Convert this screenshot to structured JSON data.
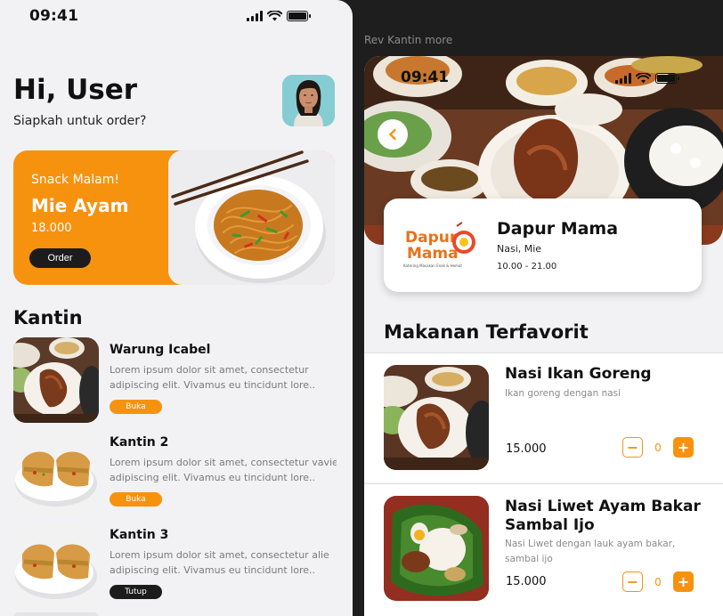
{
  "left_phone": {
    "status_time": "09:41",
    "greeting": "Hi, User",
    "subtitle": "Siapkah untuk order?",
    "promo": {
      "label": "Snack Malam!",
      "title": "Mie Ayam",
      "price": "18.000",
      "button": "Order"
    },
    "kantin_title": "Kantin",
    "kantin_items": [
      {
        "name": "Warung Icabel",
        "desc_line1": "Lorem ipsum dolor sit amet, consectetur",
        "desc_line2": "adipiscing elit. Vivamus eu tincidunt lore..",
        "status": "Buka"
      },
      {
        "name": "Kantin 2",
        "desc_line1": "Lorem ipsum dolor sit amet, consectetur vavie",
        "desc_line2": "adipiscing elit. Vivamus eu tincidunt lore..",
        "status": "Buka"
      },
      {
        "name": "Kantin 3",
        "desc_line1": "Lorem ipsum dolor sit amet, consectetur alie",
        "desc_line2": "adipiscing elit. Vivamus eu tincidunt lore..",
        "status": "Tutup"
      }
    ]
  },
  "right_frame": {
    "frame_label": "Rev Kantin more",
    "status_time": "09:41",
    "store": {
      "name": "Dapur Mama",
      "categories": "Nasi, Mie",
      "hours": "10.00 - 21.00",
      "logo_text_1": "Dapur",
      "logo_text_2": "Mama",
      "logo_tagline": "Katering Masakan Enak & Hemat"
    },
    "favorites_title": "Makanan Terfavorit",
    "menu": [
      {
        "name": "Nasi Ikan Goreng",
        "desc": "Ikan goreng dengan nasi",
        "price": "15.000",
        "qty": "0"
      },
      {
        "name": "Nasi Liwet Ayam Bakar Sambal Ijo",
        "desc": "Nasi Liwet dengan lauk ayam bakar, sambal ijo",
        "price": "15.000",
        "qty": "0"
      }
    ]
  },
  "icons": {
    "minus": "−",
    "plus": "+"
  },
  "colors": {
    "accent": "#f7920f",
    "dark": "#1c1c1c",
    "background": "#f2f2f5",
    "canvas": "#1e1e1e"
  }
}
